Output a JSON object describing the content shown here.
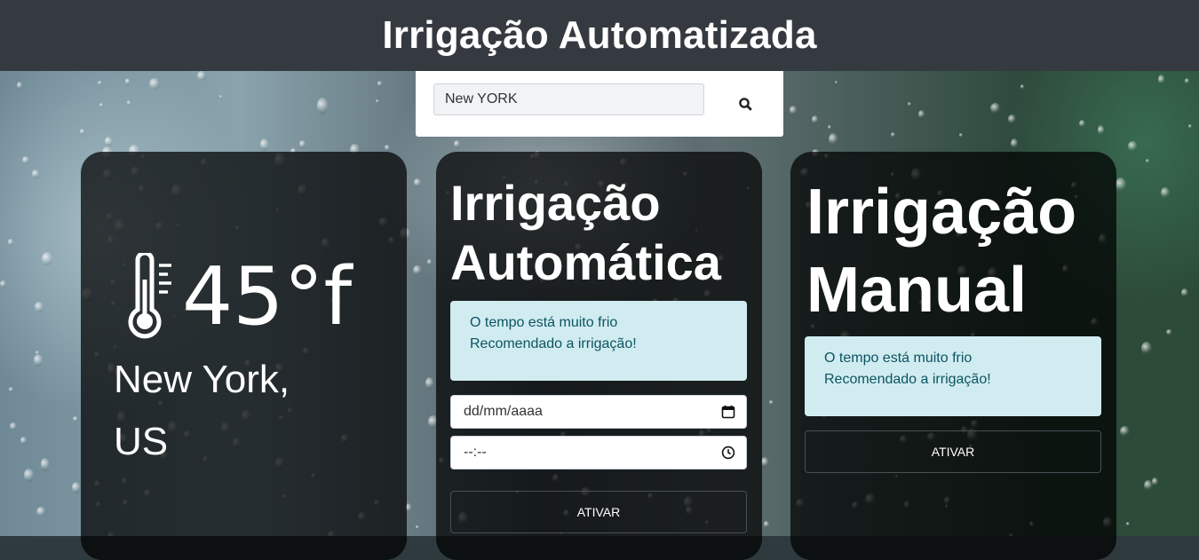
{
  "header": {
    "title": "Irrigação Automatizada"
  },
  "search": {
    "value": "New YORK",
    "icon": "search-icon"
  },
  "weather": {
    "temperature": "45°f",
    "city_line1": "New York,",
    "city_line2": "US",
    "icon": "thermometer-icon"
  },
  "auto": {
    "title_line1": "Irrigação",
    "title_line2": "Automática",
    "alert_line1": "O tempo está muito frio",
    "alert_line2": "Recomendado a irrigação!",
    "date_placeholder": "dd/mm/aaaa",
    "time_placeholder": "--:--",
    "button_label": "ATIVAR"
  },
  "manual": {
    "title_line1": "Irrigação",
    "title_line2": "Manual",
    "alert_line1": "O tempo está muito frio",
    "alert_line2": "Recomendado a irrigação!",
    "button_label": "ATIVAR"
  },
  "colors": {
    "header_bg": "#343a40",
    "alert_bg": "#d1ecf1",
    "alert_text": "#0c5460"
  }
}
